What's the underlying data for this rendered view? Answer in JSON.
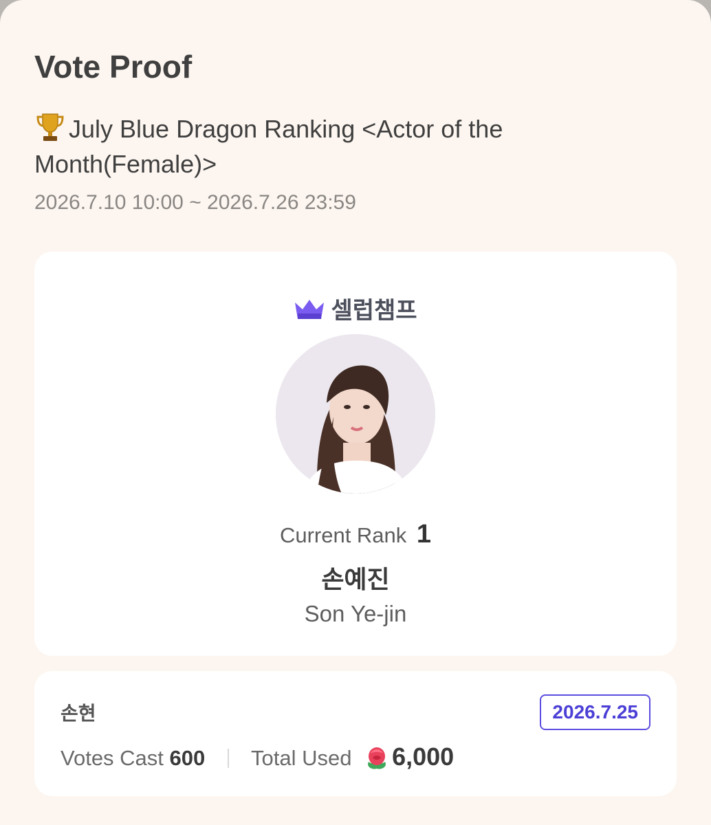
{
  "header": {
    "title": "Vote Proof",
    "event_title": "July Blue Dragon Ranking <Actor of the Month(Female)>",
    "period": "2026.7.10 10:00 ~ 2026.7.26 23:59"
  },
  "candidate_card": {
    "brand_name": "셀럽챔프",
    "rank_label": "Current Rank",
    "rank_value": "1",
    "name_korean": "손예진",
    "name_english": "Son Ye-jin",
    "avatar_icon": "portrait-photo"
  },
  "vote_card": {
    "voter_name": "손현",
    "date": "2026.7.25",
    "votes_cast_label": "Votes Cast",
    "votes_cast_value": "600",
    "total_used_label": "Total Used",
    "total_used_value": "6,000",
    "currency_icon": "rose-icon"
  },
  "colors": {
    "background": "#fdf6f0",
    "card": "#ffffff",
    "accent": "#5c4ee0",
    "crown": "#7b5cf0"
  }
}
